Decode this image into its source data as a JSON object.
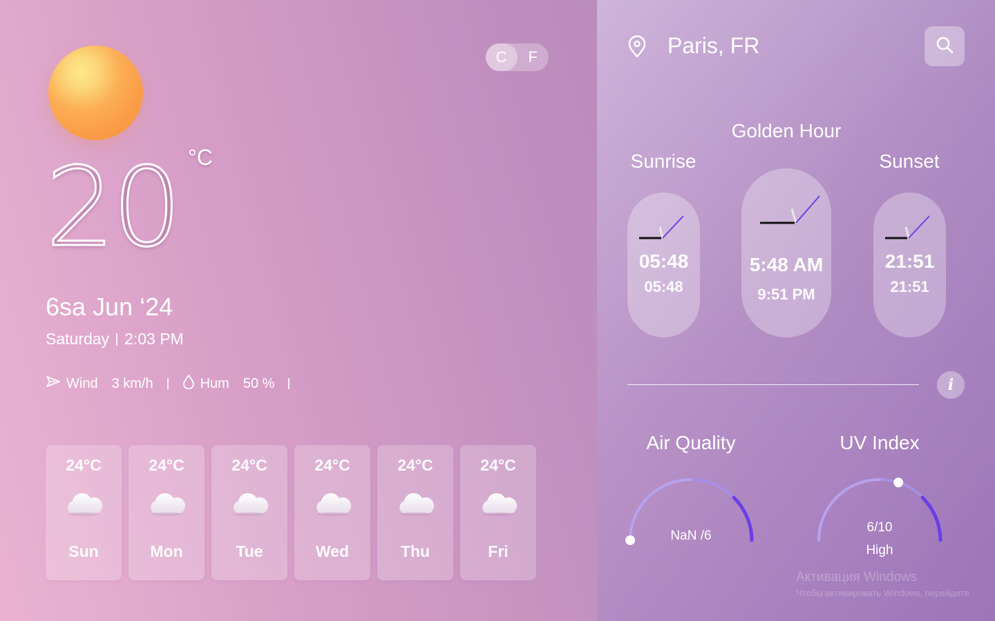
{
  "current": {
    "temperature": "20",
    "unit_symbol": "°C",
    "date_main": "6sa Jun ‘24",
    "weekday": "Saturday",
    "time": "2:03 PM",
    "wind_label": "Wind",
    "wind_value": "3 km/h",
    "humidity_label": "Hum",
    "humidity_value": "50 %",
    "condition_icon": "sun-icon"
  },
  "unit_toggle": {
    "celsius": "C",
    "fahrenheit": "F",
    "selected": "C"
  },
  "forecast": [
    {
      "temp": "24°C",
      "day": "Sun",
      "icon": "cloud-icon"
    },
    {
      "temp": "24°C",
      "day": "Mon",
      "icon": "cloud-icon"
    },
    {
      "temp": "24°C",
      "day": "Tue",
      "icon": "cloud-icon"
    },
    {
      "temp": "24°C",
      "day": "Wed",
      "icon": "cloud-icon"
    },
    {
      "temp": "24°C",
      "day": "Thu",
      "icon": "cloud-icon"
    },
    {
      "temp": "24°C",
      "day": "Fri",
      "icon": "cloud-icon"
    }
  ],
  "location": {
    "name": "Paris, FR"
  },
  "golden_hour": {
    "title": "Golden Hour",
    "sunrise_label": "Sunrise",
    "sunset_label": "Sunset",
    "sunrise_big": "05:48",
    "sunrise_small": "05:48",
    "golden_big": "5:48 AM",
    "golden_small": "9:51 PM",
    "sunset_big": "21:51",
    "sunset_small": "21:51"
  },
  "air_quality": {
    "title": "Air Quality",
    "value_text": "NaN /6",
    "level": 0
  },
  "uv_index": {
    "title": "UV Index",
    "value_text": "6/10",
    "level_text": "High",
    "level": 0.6
  },
  "watermark": {
    "line1": "Активация Windows",
    "line2": "Чтобы активировать Windows, перейдите"
  },
  "colors": {
    "accent_purple": "#6a3fe6",
    "gauge_light": "#b8a2ee",
    "sun_orange": "#fa9c45"
  }
}
